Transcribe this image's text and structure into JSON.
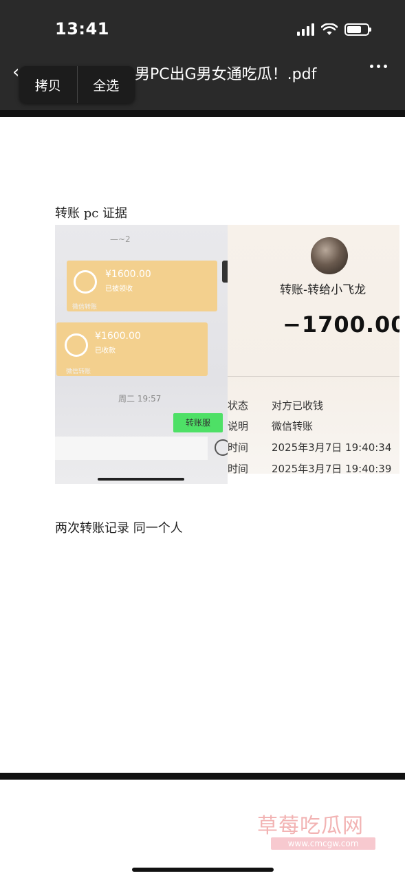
{
  "status_bar": {
    "time": "13:41"
  },
  "header": {
    "back_icon": "chevron-left-icon",
    "title": "男PC出G男女通吃瓜！.pdf",
    "more_icon": "more-dots-icon"
  },
  "context_menu": {
    "copy": "拷贝",
    "select_all": "全选"
  },
  "document": {
    "caption_top": "转账 pc 证据",
    "caption_bottom": "两次转账记录  同一个人",
    "left_photo": {
      "card1_amount": "¥1600.00",
      "card1_status": "已被领收",
      "card1_footer": "微信转账",
      "card2_amount": "¥1600.00",
      "card2_status": "已收款",
      "card2_footer": "微信转账",
      "time": "周二 19:57",
      "green_button": "转账服"
    },
    "right_photo": {
      "to_line": "转账-转给小飞龙",
      "amount": "−1700.00",
      "rows": [
        {
          "key": "状态",
          "value": "对方已收钱"
        },
        {
          "key": "说明",
          "value": "微信转账"
        },
        {
          "key": "时间",
          "value": "2025年3月7日 19:40:34"
        },
        {
          "key": "时间",
          "value": "2025年3月7日 19:40:39"
        }
      ]
    }
  },
  "watermark": {
    "title": "草莓吃瓜网",
    "url": "www.cmcgw.com"
  }
}
